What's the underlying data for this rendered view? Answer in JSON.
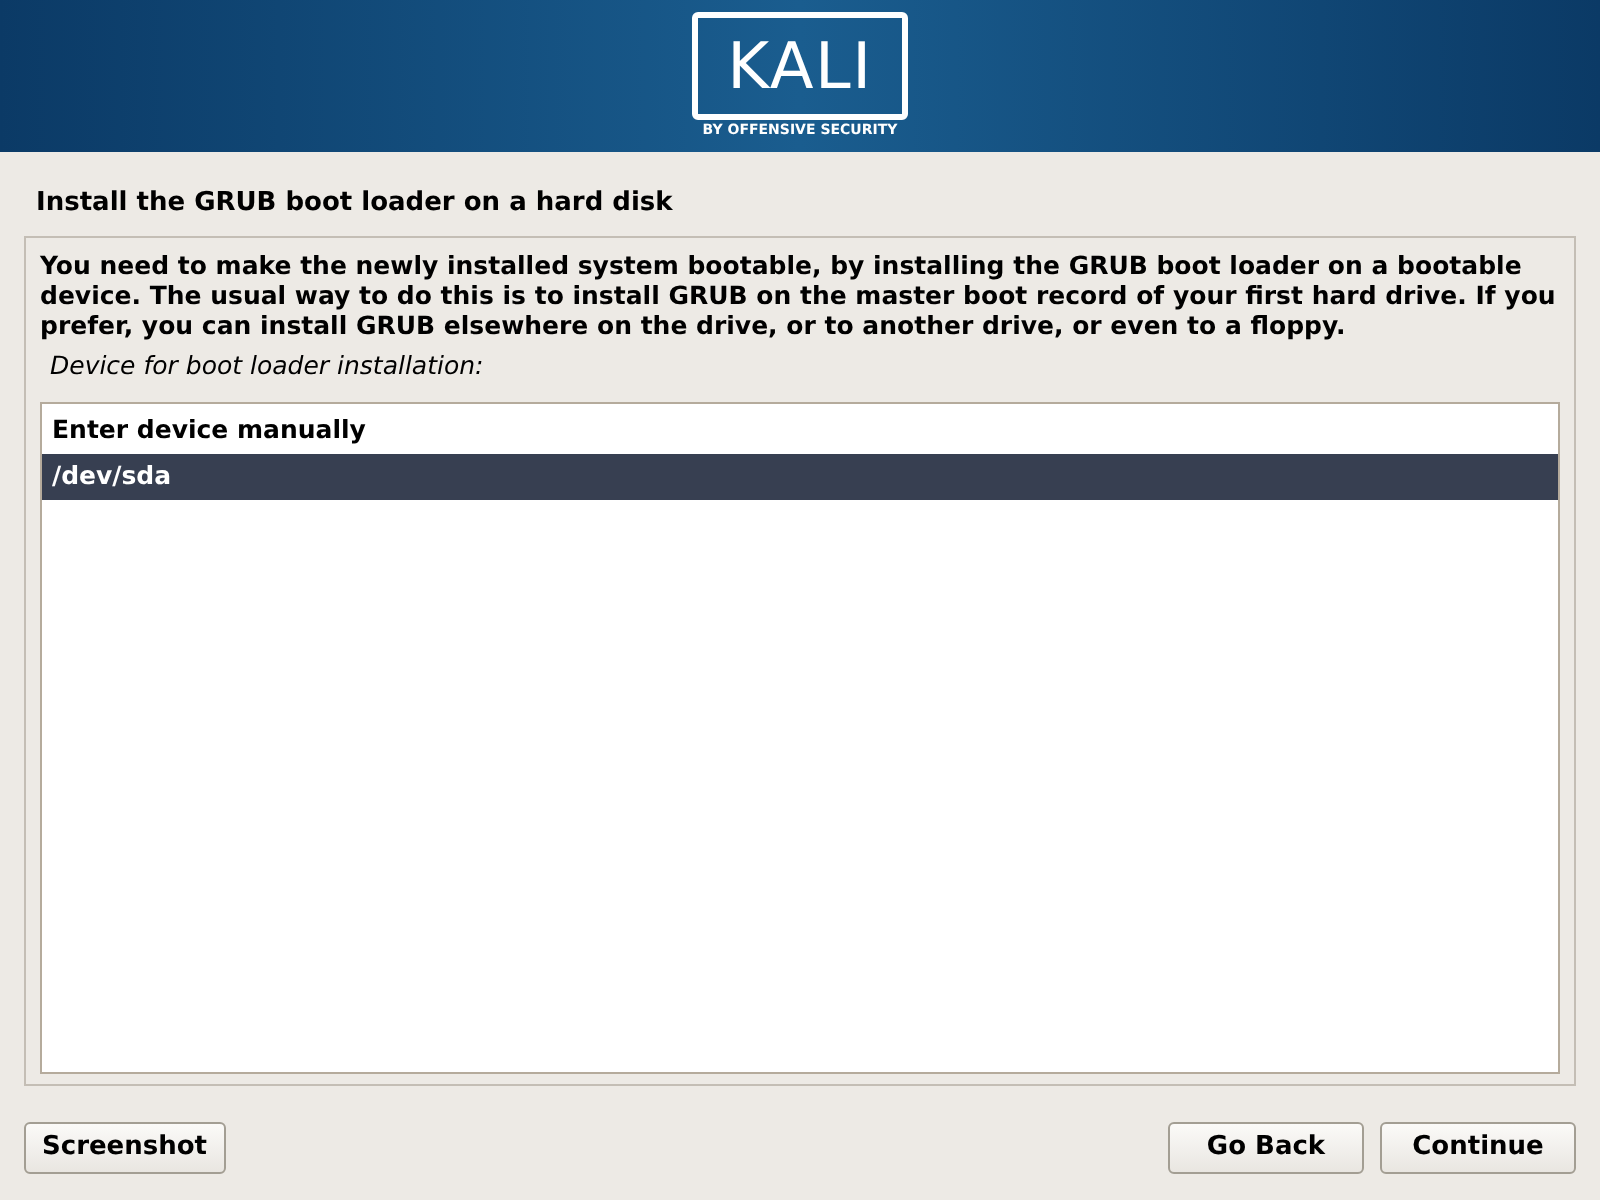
{
  "banner": {
    "logo_text": "KALI",
    "tagline": "BY OFFENSIVE SECURITY"
  },
  "title": "Install the GRUB boot loader on a hard disk",
  "description": "You need to make the newly installed system bootable, by installing the GRUB boot loader on a bootable device. The usual way to do this is to install GRUB on the master boot record of your first hard drive. If you prefer, you can install GRUB elsewhere on the drive, or to another drive, or even to a floppy.",
  "prompt": "Device for boot loader installation:",
  "options": [
    {
      "label": "Enter device manually",
      "selected": false
    },
    {
      "label": "/dev/sda",
      "selected": true
    }
  ],
  "buttons": {
    "left": [
      "Screenshot"
    ],
    "right": [
      "Go Back",
      "Continue"
    ]
  }
}
